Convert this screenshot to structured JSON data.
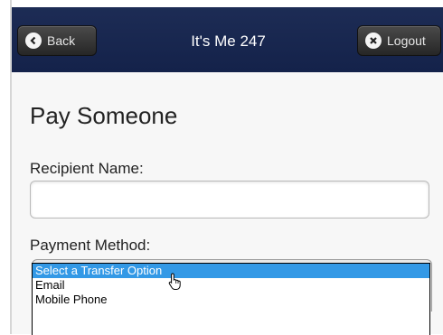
{
  "header": {
    "back_label": "Back",
    "title": "It's Me 247",
    "logout_label": "Logout"
  },
  "page": {
    "title": "Pay Someone",
    "recipient_label": "Recipient Name:",
    "recipient_value": "",
    "payment_method_label": "Payment Method:"
  },
  "payment_method": {
    "options": [
      "Select a Transfer Option",
      "Email",
      "Mobile Phone"
    ],
    "selected": "Select a Transfer Option"
  },
  "colors": {
    "header_bg": "#14224a",
    "option_highlight": "#3399e6"
  },
  "icons": {
    "back": "chevron-left-icon",
    "logout": "close-icon",
    "cursor": "hand-pointer-icon"
  }
}
